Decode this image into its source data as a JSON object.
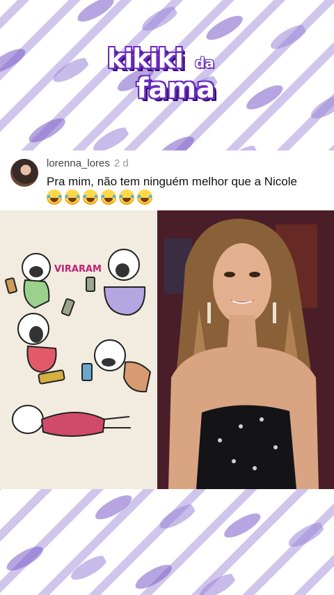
{
  "logo": {
    "line1": "kikiki",
    "line2": "da",
    "line3": "fama"
  },
  "comment": {
    "username": "lorenna_lores",
    "time": "2 d",
    "text": "Pra mim, não tem ninguém melhor que a Nicole",
    "emoji_count": 6
  },
  "images": {
    "cartoon_caption": "VIRARAM"
  },
  "colors": {
    "pattern": "#7b5cc9",
    "logo_outline": "#6a2bbf",
    "accent": "#c02070"
  }
}
